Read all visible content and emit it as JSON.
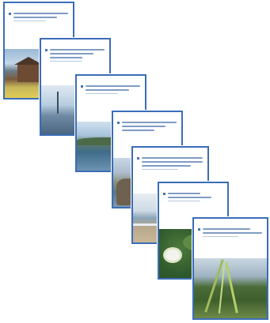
{
  "colors": {
    "cover_border": "#3b6db8",
    "background": "#ffffff"
  },
  "covers": [
    {
      "id": "cover-1",
      "photo": "barn-landscape"
    },
    {
      "id": "cover-2",
      "photo": "harbor-masts"
    },
    {
      "id": "cover-3",
      "photo": "island-water"
    },
    {
      "id": "cover-4",
      "photo": "rocky-shore"
    },
    {
      "id": "cover-5",
      "photo": "beach-waves"
    },
    {
      "id": "cover-6",
      "photo": "water-lily"
    },
    {
      "id": "cover-7",
      "photo": "reeds"
    }
  ]
}
